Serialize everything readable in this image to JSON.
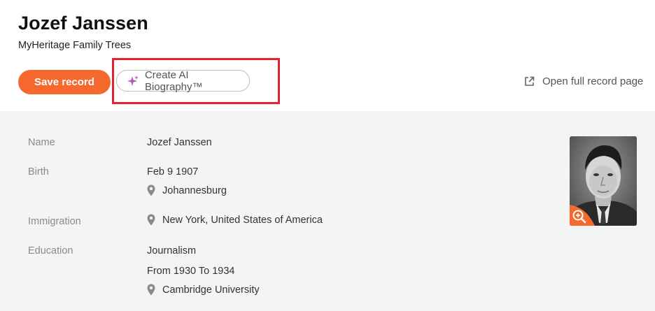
{
  "record": {
    "title": "Jozef Janssen",
    "source": "MyHeritage Family Trees"
  },
  "actions": {
    "save_label": "Save record",
    "ai_bio_label": "Create AI Biography™",
    "open_full_label": "Open full record page"
  },
  "fields": {
    "name": {
      "label": "Name",
      "value": "Jozef Janssen"
    },
    "birth": {
      "label": "Birth",
      "date": "Feb 9 1907",
      "place": "Johannesburg"
    },
    "immigration": {
      "label": "Immigration",
      "place": "New York, United States of America"
    },
    "education": {
      "label": "Education",
      "field": "Journalism",
      "period": "From 1930 To 1934",
      "place": "Cambridge University"
    }
  },
  "icons": {
    "sparkle": "sparkle-icon",
    "external_link": "external-link-icon",
    "location_pin": "location-pin-icon",
    "zoom": "zoom-in-icon"
  },
  "colors": {
    "accent": "#f5692f",
    "highlight": "#e0232f"
  }
}
